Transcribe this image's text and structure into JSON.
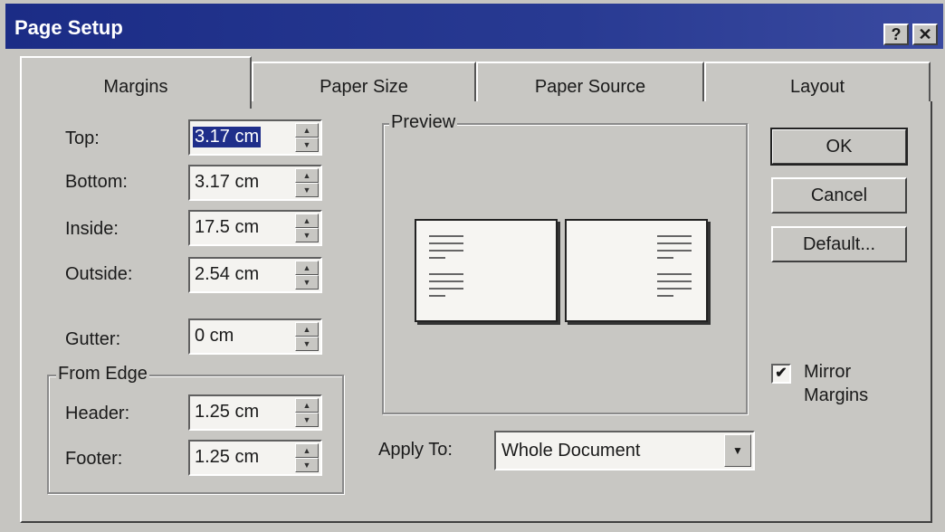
{
  "window": {
    "title": "Page Setup",
    "help_glyph": "?",
    "close_glyph": "✕"
  },
  "tabs": [
    {
      "label": "Margins",
      "active": true
    },
    {
      "label": "Paper Size",
      "active": false
    },
    {
      "label": "Paper Source",
      "active": false
    },
    {
      "label": "Layout",
      "active": false
    }
  ],
  "margins": {
    "top": {
      "label": "Top:",
      "value": "3.17 cm"
    },
    "bottom": {
      "label": "Bottom:",
      "value": "3.17 cm"
    },
    "inside": {
      "label": "Inside:",
      "value": "17.5 cm"
    },
    "outside": {
      "label": "Outside:",
      "value": "2.54 cm"
    },
    "gutter": {
      "label": "Gutter:",
      "value": "0 cm"
    }
  },
  "from_edge": {
    "title": "From Edge",
    "header": {
      "label": "Header:",
      "value": "1.25 cm"
    },
    "footer": {
      "label": "Footer:",
      "value": "1.25 cm"
    }
  },
  "preview": {
    "title": "Preview"
  },
  "apply_to": {
    "label": "Apply To:",
    "value": "Whole Document"
  },
  "buttons": {
    "ok": "OK",
    "cancel": "Cancel",
    "default": "Default..."
  },
  "mirror_margins": {
    "label_line1": "Mirror",
    "label_line2": "Margins",
    "checked": true,
    "check_glyph": "✔"
  },
  "icons": {
    "spin_up": "▲",
    "spin_down": "▼",
    "dropdown": "▼"
  }
}
